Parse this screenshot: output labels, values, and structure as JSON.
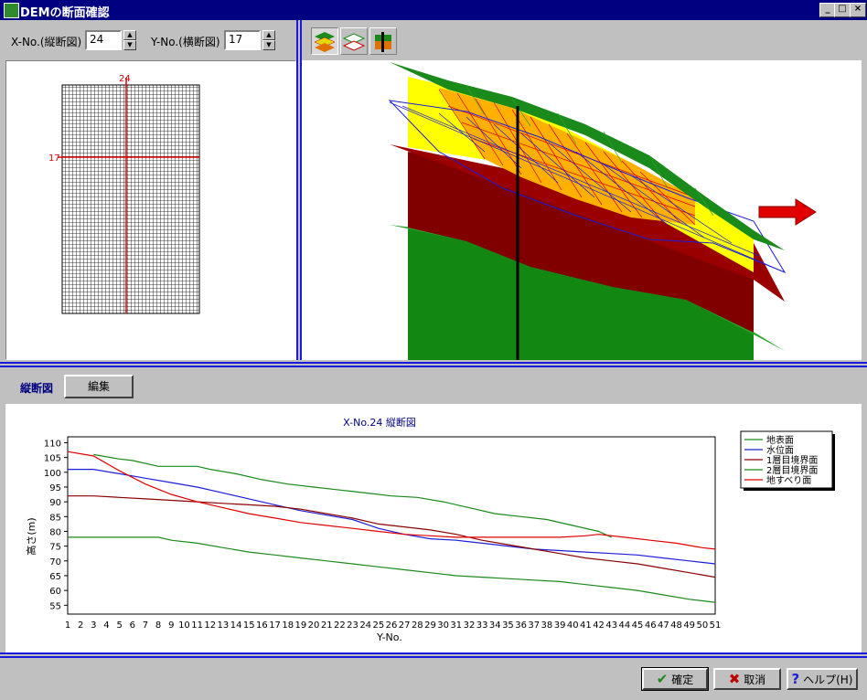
{
  "window": {
    "title": "DEMの断面確認",
    "controls": [
      "_",
      "□",
      "×"
    ]
  },
  "controls": {
    "x_label": "X-No.(縦断図)",
    "x_value": "24",
    "y_label": "Y-No.(横断図)",
    "y_value": "17"
  },
  "plan": {
    "x_marker": "24",
    "y_marker": "17"
  },
  "toolbar": {
    "icons": [
      "layer-view-icon",
      "plane-view-icon",
      "section-view-icon"
    ]
  },
  "section": {
    "tab_label": "縦断図",
    "edit_label": "編集"
  },
  "colors": {
    "ground": "#1a8a1a",
    "water": "#1e1ed8",
    "layer1": "#8b0000",
    "layer2": "#1a8a1a",
    "slide": "#e00000",
    "accent": "#000080",
    "panel": "#c0c0c0"
  },
  "chart_data": {
    "type": "line",
    "title": "X-No.24 縦断図",
    "xlabel": "Y-No.",
    "ylabel": "高さ(m)",
    "ylim": [
      52,
      112
    ],
    "yticks": [
      55,
      60,
      65,
      70,
      75,
      80,
      85,
      90,
      95,
      100,
      105,
      110
    ],
    "x": [
      1,
      2,
      3,
      4,
      5,
      6,
      7,
      8,
      9,
      10,
      11,
      12,
      13,
      14,
      15,
      16,
      17,
      18,
      19,
      20,
      21,
      22,
      23,
      24,
      25,
      26,
      27,
      28,
      29,
      30,
      31,
      32,
      33,
      34,
      35,
      36,
      37,
      38,
      39,
      40,
      41,
      42,
      43,
      44,
      45,
      46,
      47,
      48,
      49,
      50,
      51
    ],
    "legend": [
      "地表面",
      "水位面",
      "1層目境界面",
      "2層目境界面",
      "地すべり面"
    ],
    "series": [
      {
        "name": "地表面",
        "color": "#1a8a1a",
        "points": [
          [
            3,
            106
          ],
          [
            5,
            104.5
          ],
          [
            6,
            104
          ],
          [
            8,
            102
          ],
          [
            10,
            102
          ],
          [
            11,
            102
          ],
          [
            12,
            101
          ],
          [
            14,
            99.5
          ],
          [
            16,
            97.5
          ],
          [
            18,
            96
          ],
          [
            20,
            95
          ],
          [
            22,
            94
          ],
          [
            24,
            93
          ],
          [
            26,
            92
          ],
          [
            28,
            91.5
          ],
          [
            30,
            90
          ],
          [
            32,
            88
          ],
          [
            34,
            86
          ],
          [
            36,
            85
          ],
          [
            38,
            84
          ],
          [
            40,
            82
          ],
          [
            42,
            80
          ],
          [
            43,
            78
          ]
        ]
      },
      {
        "name": "水位面",
        "color": "#1e1ed8",
        "points": [
          [
            1,
            101
          ],
          [
            3,
            101
          ],
          [
            5,
            99.5
          ],
          [
            7,
            98
          ],
          [
            9,
            96.5
          ],
          [
            11,
            95
          ],
          [
            13,
            93
          ],
          [
            15,
            91
          ],
          [
            17,
            89
          ],
          [
            19,
            87
          ],
          [
            21,
            85.5
          ],
          [
            23,
            84
          ],
          [
            25,
            81
          ],
          [
            27,
            79
          ],
          [
            29,
            77.5
          ],
          [
            31,
            77
          ],
          [
            33,
            76
          ],
          [
            35,
            75
          ],
          [
            37,
            74
          ],
          [
            39,
            73.5
          ],
          [
            41,
            73
          ],
          [
            43,
            72.5
          ],
          [
            45,
            72
          ],
          [
            47,
            71
          ],
          [
            49,
            70
          ],
          [
            51,
            69
          ]
        ]
      },
      {
        "name": "1層目境界面",
        "color": "#8b0000",
        "points": [
          [
            1,
            92
          ],
          [
            3,
            92
          ],
          [
            5,
            91.5
          ],
          [
            7,
            91
          ],
          [
            9,
            90.5
          ],
          [
            11,
            90
          ],
          [
            13,
            89.5
          ],
          [
            15,
            89
          ],
          [
            17,
            88.5
          ],
          [
            19,
            87.5
          ],
          [
            21,
            86
          ],
          [
            23,
            84.5
          ],
          [
            25,
            82.5
          ],
          [
            27,
            81.5
          ],
          [
            29,
            80.5
          ],
          [
            31,
            79
          ],
          [
            33,
            77
          ],
          [
            35,
            75.5
          ],
          [
            37,
            74
          ],
          [
            39,
            72.5
          ],
          [
            41,
            71
          ],
          [
            43,
            70
          ],
          [
            45,
            69
          ],
          [
            47,
            67.5
          ],
          [
            49,
            66
          ],
          [
            51,
            64.5
          ]
        ]
      },
      {
        "name": "2層目境界面",
        "color": "#1a8a1a",
        "points": [
          [
            1,
            78
          ],
          [
            3,
            78
          ],
          [
            5,
            78
          ],
          [
            8,
            78
          ],
          [
            9,
            77
          ],
          [
            11,
            76
          ],
          [
            13,
            74.5
          ],
          [
            15,
            73
          ],
          [
            17,
            72
          ],
          [
            19,
            71
          ],
          [
            21,
            70
          ],
          [
            23,
            69
          ],
          [
            25,
            68
          ],
          [
            27,
            67
          ],
          [
            29,
            66
          ],
          [
            31,
            65
          ],
          [
            33,
            64.5
          ],
          [
            35,
            64
          ],
          [
            37,
            63.5
          ],
          [
            39,
            63
          ],
          [
            41,
            62
          ],
          [
            43,
            61
          ],
          [
            45,
            60
          ],
          [
            47,
            58.5
          ],
          [
            49,
            57
          ],
          [
            51,
            56
          ]
        ]
      },
      {
        "name": "地すべり面",
        "color": "#e00000",
        "points": [
          [
            1,
            107
          ],
          [
            3,
            105.5
          ],
          [
            5,
            100.5
          ],
          [
            7,
            96
          ],
          [
            9,
            92.5
          ],
          [
            11,
            90
          ],
          [
            13,
            88
          ],
          [
            15,
            86
          ],
          [
            17,
            84.5
          ],
          [
            19,
            83
          ],
          [
            21,
            82
          ],
          [
            23,
            81
          ],
          [
            25,
            80
          ],
          [
            27,
            79
          ],
          [
            29,
            78.5
          ],
          [
            31,
            78
          ],
          [
            33,
            78
          ],
          [
            35,
            78
          ],
          [
            37,
            78
          ],
          [
            39,
            78
          ],
          [
            41,
            78.5
          ],
          [
            42,
            79
          ],
          [
            44,
            78
          ],
          [
            46,
            77
          ],
          [
            48,
            76
          ],
          [
            50,
            74.5
          ],
          [
            51,
            74
          ]
        ]
      }
    ]
  },
  "footer": {
    "ok_label": "確定",
    "cancel_label": "取消",
    "help_label": "ヘルプ(H)"
  }
}
